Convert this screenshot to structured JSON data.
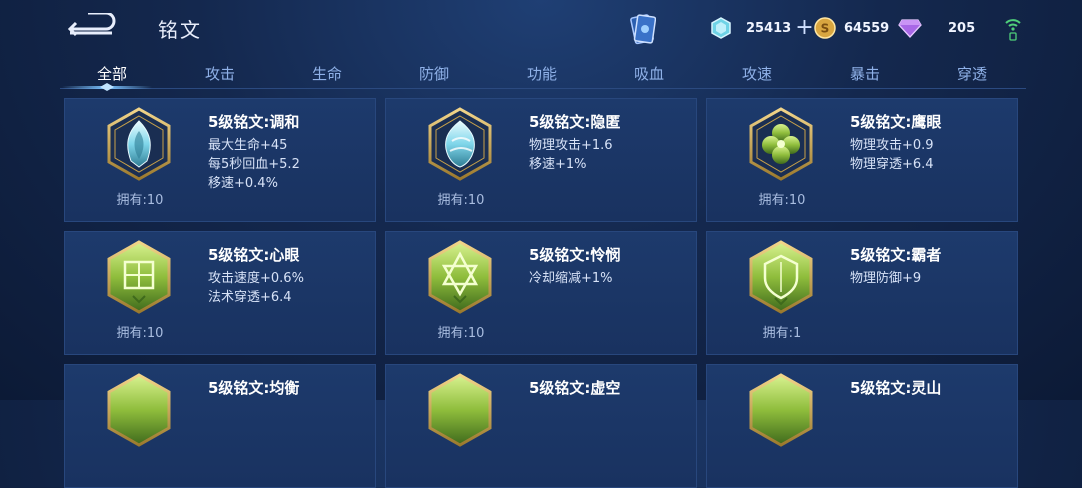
{
  "header": {
    "title": "铭文"
  },
  "resources": {
    "crystal": "25413",
    "gold": "64559",
    "gem": "205"
  },
  "tabs": [
    "全部",
    "攻击",
    "生命",
    "防御",
    "功能",
    "吸血",
    "攻速",
    "暴击",
    "穿透"
  ],
  "colors": {
    "green": "#8fbd3c",
    "teal": "#6fd3e6",
    "gold": "#c9a24a"
  },
  "cards": [
    {
      "name": "5级铭文:调和",
      "owned": "拥有:10",
      "icon": "teal-flame-emblem",
      "stats": [
        "最大生命+45",
        "每5秒回血+5.2",
        "移速+0.4%"
      ]
    },
    {
      "name": "5级铭文:隐匿",
      "owned": "拥有:10",
      "icon": "teal-flame-emblem",
      "stats": [
        "物理攻击+1.6",
        "移速+1%"
      ]
    },
    {
      "name": "5级铭文:鹰眼",
      "owned": "拥有:10",
      "icon": "green-clover-emblem",
      "stats": [
        "物理攻击+0.9",
        "物理穿透+6.4"
      ]
    },
    {
      "name": "5级铭文:心眼",
      "owned": "拥有:10",
      "icon": "green-gate-emblem",
      "stats": [
        "攻击速度+0.6%",
        "法术穿透+6.4"
      ]
    },
    {
      "name": "5级铭文:怜悯",
      "owned": "拥有:10",
      "icon": "green-star-emblem",
      "stats": [
        "冷却缩减+1%"
      ]
    },
    {
      "name": "5级铭文:霸者",
      "owned": "拥有:1",
      "icon": "green-shield-emblem",
      "stats": [
        "物理防御+9"
      ]
    },
    {
      "name": "5级铭文:均衡",
      "owned": "",
      "icon": "green-emblem",
      "stats": []
    },
    {
      "name": "5级铭文:虚空",
      "owned": "",
      "icon": "green-emblem",
      "stats": []
    },
    {
      "name": "5级铭文:灵山",
      "owned": "",
      "icon": "green-emblem",
      "stats": []
    }
  ]
}
